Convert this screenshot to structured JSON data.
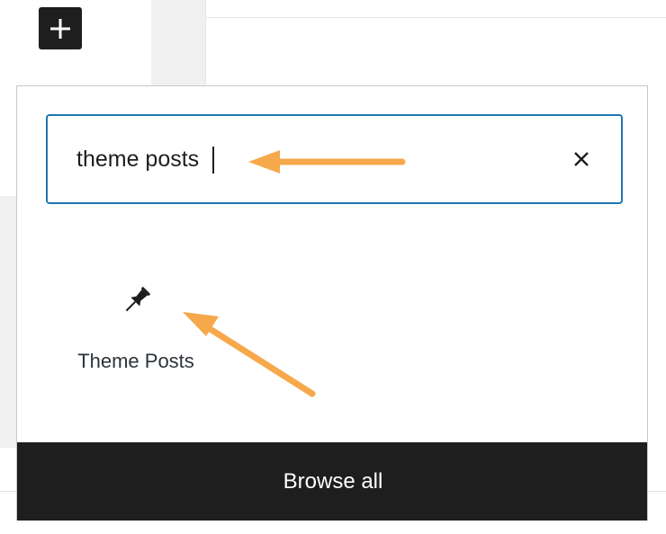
{
  "inserter": {
    "toggle_icon": "plus-icon",
    "search": {
      "value": "theme posts",
      "clear_icon": "close-icon"
    },
    "results": [
      {
        "label": "Theme Posts",
        "icon": "pin-icon"
      }
    ],
    "browse_all_label": "Browse all"
  },
  "colors": {
    "accent": "#1f76b3",
    "dark": "#1e1e1e",
    "annotation_arrow": "#f6a84b"
  }
}
